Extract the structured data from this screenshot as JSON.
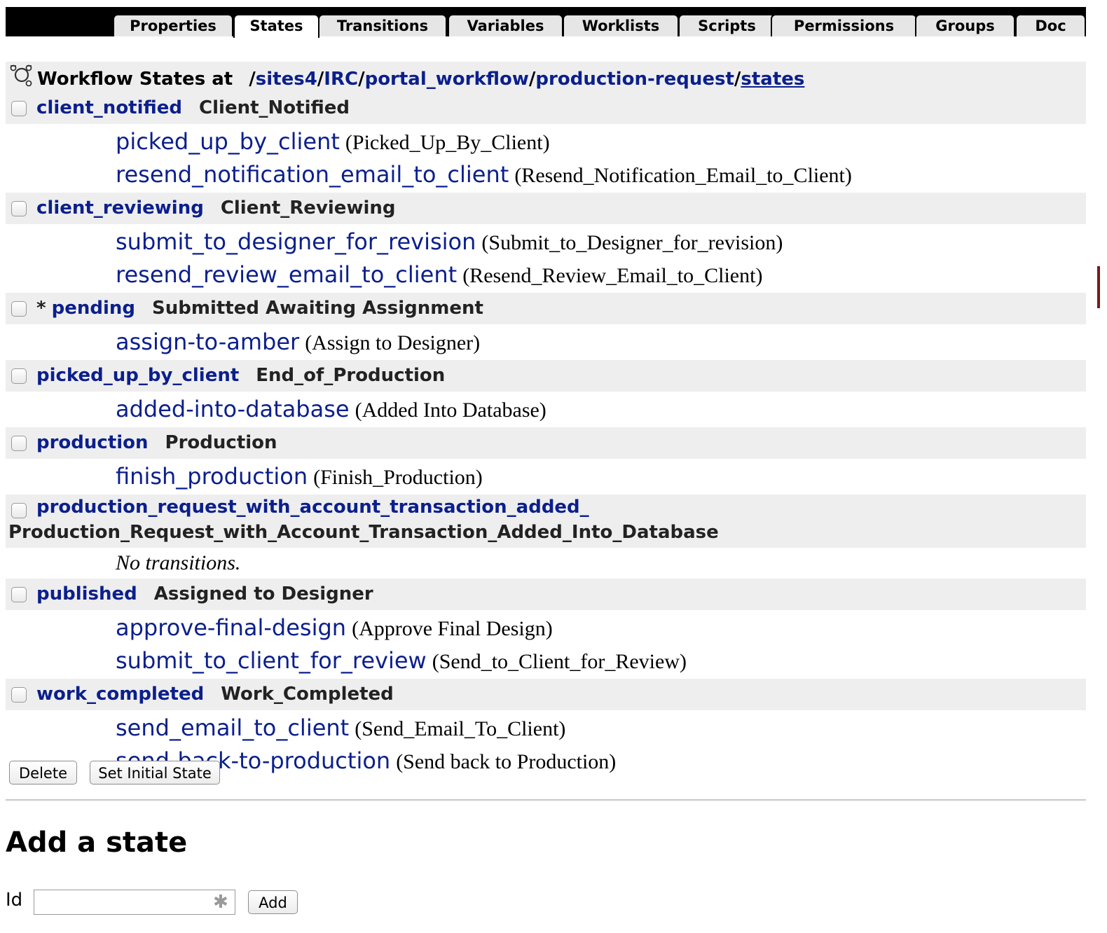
{
  "tabs": [
    {
      "label": "Properties",
      "active": false
    },
    {
      "label": "States",
      "active": true
    },
    {
      "label": "Transitions",
      "active": false
    },
    {
      "label": "Variables",
      "active": false
    },
    {
      "label": "Worklists",
      "active": false
    },
    {
      "label": "Scripts",
      "active": false
    },
    {
      "label": "Permissions",
      "active": false
    },
    {
      "label": "Groups",
      "active": false
    },
    {
      "label": "Doc",
      "active": false
    }
  ],
  "header": {
    "title": "Workflow States at",
    "path": [
      {
        "label": "/",
        "link": false
      },
      {
        "label": "sites4",
        "link": true
      },
      {
        "label": "/",
        "link": false
      },
      {
        "label": "IRC",
        "link": true
      },
      {
        "label": "/",
        "link": false
      },
      {
        "label": "portal_workflow",
        "link": true
      },
      {
        "label": "/",
        "link": false
      },
      {
        "label": "production-request",
        "link": true
      },
      {
        "label": "/",
        "link": false
      },
      {
        "label": "states",
        "link": true
      }
    ],
    "icon": "workflow-icon"
  },
  "states": [
    {
      "id": "client_notified",
      "title": "Client_Notified",
      "initial": false,
      "transitions": [
        {
          "id": "picked_up_by_client",
          "title": "(Picked_Up_By_Client)"
        },
        {
          "id": "resend_notification_email_to_client",
          "title": "(Resend_Notification_Email_to_Client)"
        }
      ]
    },
    {
      "id": "client_reviewing",
      "title": "Client_Reviewing",
      "initial": false,
      "transitions": [
        {
          "id": "submit_to_designer_for_revision",
          "title": "(Submit_to_Designer_for_revision)"
        },
        {
          "id": "resend_review_email_to_client",
          "title": "(Resend_Review_Email_to_Client)"
        }
      ]
    },
    {
      "id": "pending",
      "title": "Submitted Awaiting Assignment",
      "initial": true,
      "initial_marker": "*",
      "transitions": [
        {
          "id": "assign-to-amber",
          "title": "(Assign to Designer)"
        }
      ]
    },
    {
      "id": "picked_up_by_client",
      "title": "End_of_Production",
      "initial": false,
      "transitions": [
        {
          "id": "added-into-database",
          "title": "(Added Into Database)"
        }
      ]
    },
    {
      "id": "production",
      "title": "Production",
      "initial": false,
      "transitions": [
        {
          "id": "finish_production",
          "title": "(Finish_Production)"
        }
      ]
    },
    {
      "id": "production_request_with_account_transaction_added_",
      "title": "Production_Request_with_Account_Transaction_Added_Into_Database",
      "initial": false,
      "no_transitions": "No transitions.",
      "transitions": []
    },
    {
      "id": "published",
      "title": "Assigned to Designer",
      "initial": false,
      "transitions": [
        {
          "id": "approve-final-design",
          "title": "(Approve Final Design)"
        },
        {
          "id": "submit_to_client_for_review",
          "title": "(Send_to_Client_for_Review)"
        }
      ]
    },
    {
      "id": "work_completed",
      "title": "Work_Completed",
      "initial": false,
      "transitions": [
        {
          "id": "send_email_to_client",
          "title": "(Send_Email_To_Client)"
        },
        {
          "id": "send-back-to-production",
          "title": "(Send back to Production)"
        }
      ]
    }
  ],
  "buttons": {
    "delete": "Delete",
    "set_initial": "Set Initial State"
  },
  "add_state": {
    "heading": "Add a state",
    "id_label": "Id",
    "id_value": "",
    "required_icon": "required-asterisk-icon",
    "add_button": "Add"
  }
}
